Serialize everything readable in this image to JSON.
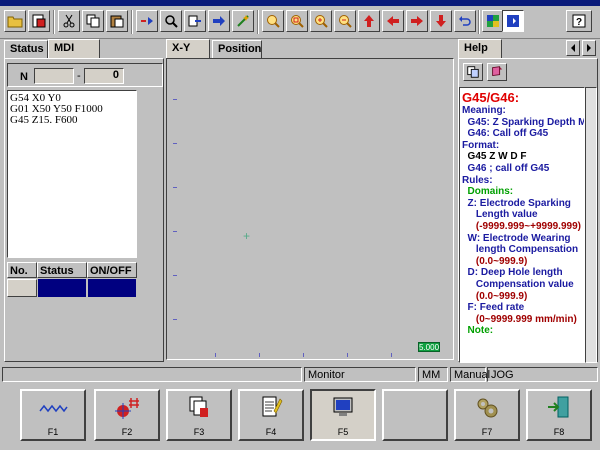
{
  "toolbar": {
    "icons": [
      "open-folder",
      "save",
      "cut",
      "copy",
      "paste",
      "find-replace",
      "search",
      "replace",
      "goto",
      "macro-wand",
      "zoom-in",
      "zoom-fit",
      "zoom-plus",
      "zoom-minus",
      "arrow-up",
      "arrow-left",
      "arrow-right",
      "arrow-down",
      "undo",
      "color-square",
      "sidebar-toggle",
      "help"
    ]
  },
  "left_panel": {
    "tabs": [
      "Status",
      "MDI"
    ],
    "n_label": "N",
    "n_first": "",
    "n_dash": "-",
    "n_second": "0",
    "program_lines": [
      "G54 X0 Y0",
      "G01 X50 Y50 F1000",
      "G45 Z15. F600"
    ],
    "table_headers": [
      "No.",
      "Status",
      "ON/OFF"
    ],
    "table_rows": [
      {
        "no": "",
        "status": "",
        "onoff": ""
      }
    ]
  },
  "center_panel": {
    "tabs": [
      "X-Y",
      "Position"
    ],
    "scale_badge": "5.000"
  },
  "help_panel": {
    "tab": "Help",
    "lines": [
      {
        "text": "G45/G46:",
        "color": "#e00000",
        "size": "title"
      },
      {
        "text": "Meaning:",
        "color": "#1a1aa0"
      },
      {
        "text": "  G45: Z Sparking Depth M",
        "color": "#1a1aa0"
      },
      {
        "text": "  G46: Call off G45",
        "color": "#1a1aa0"
      },
      {
        "text": "Format:",
        "color": "#1a1aa0"
      },
      {
        "text": "  G45 Z W D F",
        "color": "#000000"
      },
      {
        "text": "  G46    ; call off G45",
        "color": "#1a1aa0"
      },
      {
        "text": "Rules:",
        "color": "#1a1aa0"
      },
      {
        "text": "  Domains:",
        "color": "#00a000"
      },
      {
        "text": "  Z: Electrode Sparking",
        "color": "#1a1aa0"
      },
      {
        "text": "     Length value",
        "color": "#1a1aa0"
      },
      {
        "text": "     (-9999.999~+9999.999)",
        "color": "#a00000"
      },
      {
        "text": "  W: Electrode Wearing",
        "color": "#1a1aa0"
      },
      {
        "text": "     length Compensation",
        "color": "#1a1aa0"
      },
      {
        "text": "     (0.0~999.9)",
        "color": "#a00000"
      },
      {
        "text": "  D: Deep Hole length",
        "color": "#1a1aa0"
      },
      {
        "text": "     Compensation value",
        "color": "#1a1aa0"
      },
      {
        "text": "     (0.0~999.9)",
        "color": "#a00000"
      },
      {
        "text": "  F: Feed rate",
        "color": "#1a1aa0"
      },
      {
        "text": "     (0~9999.999 mm/min)",
        "color": "#a00000"
      },
      {
        "text": "  Note:",
        "color": "#00a000"
      }
    ]
  },
  "status_bar": {
    "mode": "Monitor",
    "unit": "MM",
    "manual": "Manual",
    "jog": "JOG"
  },
  "function_keys": [
    {
      "label": "F1",
      "icon": "wave-icon"
    },
    {
      "label": "F2",
      "icon": "target-grid-icon"
    },
    {
      "label": "F3",
      "icon": "document-stack-icon"
    },
    {
      "label": "F4",
      "icon": "notepad-pencil-icon"
    },
    {
      "label": "F5",
      "icon": "monitor-icon"
    },
    {
      "label": "",
      "icon": ""
    },
    {
      "label": "F7",
      "icon": "gears-icon"
    },
    {
      "label": "F8",
      "icon": "exit-door-icon"
    }
  ],
  "colors": {
    "accent_blue": "#0a1a7a",
    "table_blue": "#000080"
  }
}
